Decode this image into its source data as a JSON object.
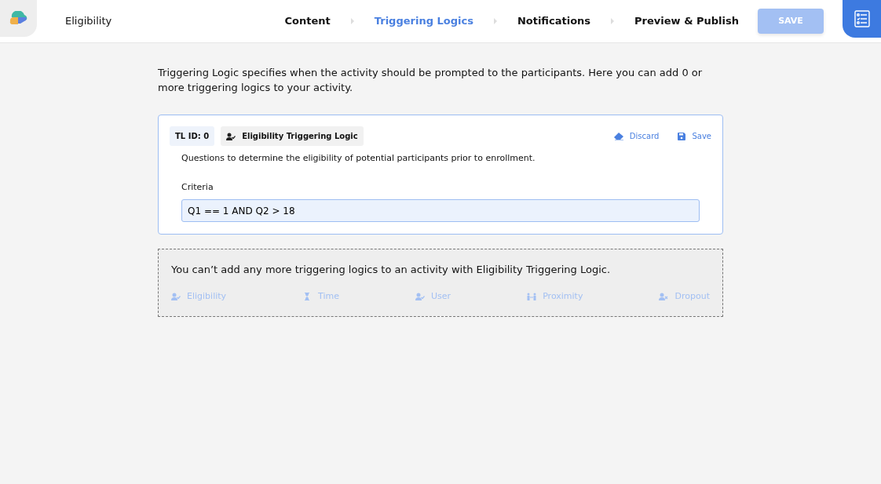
{
  "header": {
    "title": "Eligibility",
    "steps": [
      {
        "label": "Content",
        "selected": false
      },
      {
        "label": "Triggering Logics",
        "selected": true
      },
      {
        "label": "Notifications",
        "selected": false
      },
      {
        "label": "Preview & Publish",
        "selected": false
      }
    ],
    "save_button": {
      "label": "SAVE",
      "disabled": true
    }
  },
  "intro": "Triggering Logic specifies when the activity should be prompted to the participants. Here you can add 0 or more triggering logics to your activity.",
  "logic_card": {
    "id_badge": "TL ID: 0",
    "type_badge": "Eligibility Triggering Logic",
    "discard": "Discard",
    "save": "Save",
    "description": "Questions to determine the eligibility of potential participants prior to enrollment.",
    "criteria_label": "Criteria",
    "criteria_value": "Q1 == 1 AND Q2 > 18"
  },
  "add_panel": {
    "message": "You can’t add any more triggering logics to an activity with Eligibility Triggering Logic.",
    "options": [
      {
        "kind": "eligibility",
        "label": "Eligibility",
        "disabled": true
      },
      {
        "kind": "time",
        "label": "Time",
        "disabled": true
      },
      {
        "kind": "user",
        "label": "User",
        "disabled": true
      },
      {
        "kind": "proximity",
        "label": "Proximity",
        "disabled": true
      },
      {
        "kind": "dropout",
        "label": "Dropout",
        "disabled": true
      }
    ]
  }
}
